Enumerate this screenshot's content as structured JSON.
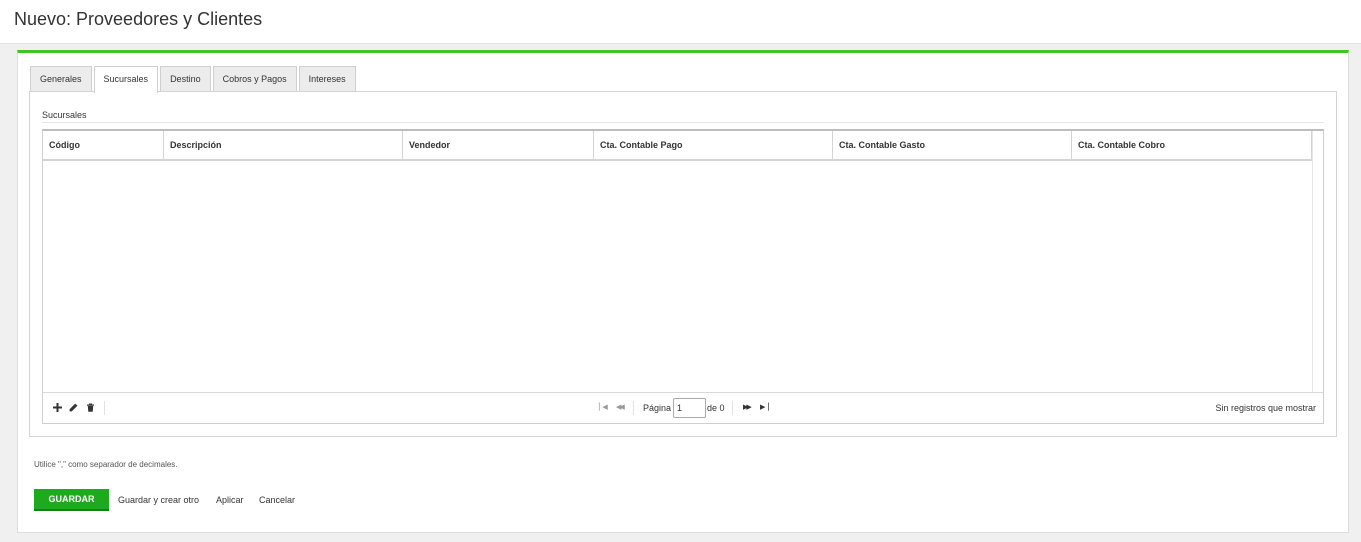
{
  "header": {
    "title": "Nuevo: Proveedores y Clientes"
  },
  "tabs": [
    {
      "label": "Generales",
      "active": false
    },
    {
      "label": "Sucursales",
      "active": true
    },
    {
      "label": "Destino",
      "active": false
    },
    {
      "label": "Cobros y Pagos",
      "active": false
    },
    {
      "label": "Intereses",
      "active": false
    }
  ],
  "section": {
    "title": "Sucursales"
  },
  "grid": {
    "columns": [
      "Código",
      "Descripción",
      "Vendedor",
      "Cta. Contable Pago",
      "Cta. Contable Gasto",
      "Cta. Contable Cobro"
    ],
    "rows": [],
    "toolbar": {
      "add_icon": "plus-icon",
      "edit_icon": "pencil-icon",
      "delete_icon": "trash-icon"
    },
    "pager": {
      "page_label": "Página",
      "page_value": "1",
      "of_label": "de 0",
      "status": "Sin registros que mostrar"
    }
  },
  "hint": "Utilice \",\" como separador de decimales.",
  "actions": {
    "save": "GUARDAR",
    "save_and_new": "Guardar y crear otro",
    "apply": "Aplicar",
    "cancel": "Cancelar"
  },
  "colors": {
    "accent": "#3ec61c",
    "save_button": "#1fa91f"
  }
}
